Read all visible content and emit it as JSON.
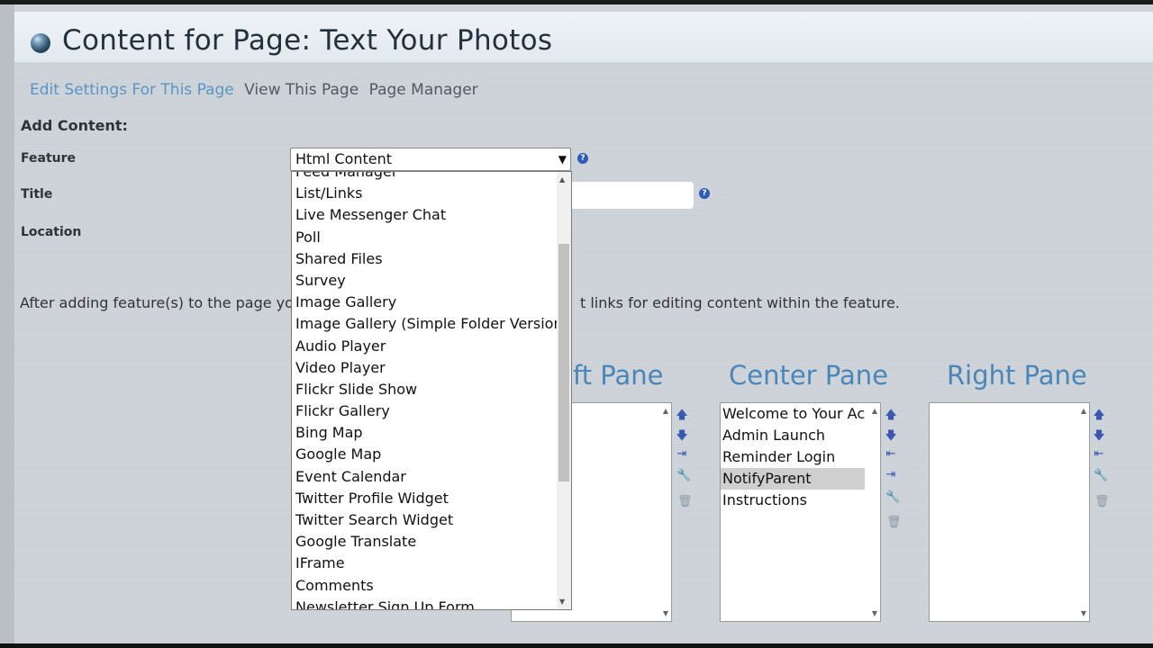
{
  "header": {
    "title": "Content for Page: Text Your Photos"
  },
  "nav": {
    "edit_settings": "Edit Settings For This Page",
    "view_page": "View This Page",
    "page_manager": "Page Manager"
  },
  "form": {
    "add_content": "Add Content:",
    "feature_label": "Feature",
    "title_label": "Title",
    "location_label": "Location",
    "feature_selected": "Html Content",
    "help_glyph": "?"
  },
  "info": {
    "part_a": "After adding feature(s) to the page you",
    "part_b": "t links for editing content within the feature."
  },
  "dropdown": {
    "options": [
      "Feed Manager",
      "List/Links",
      "Live Messenger Chat",
      "Poll",
      "Shared Files",
      "Survey",
      "Image Gallery",
      "Image Gallery (Simple Folder Version)",
      "Audio Player",
      "Video Player",
      "Flickr Slide Show",
      "Flickr Gallery",
      "Bing Map",
      "Google Map",
      "Event Calendar",
      "Twitter Profile Widget",
      "Twitter Search Widget",
      "Google Translate",
      "IFrame",
      "Comments",
      "Newsletter Sign Up Form"
    ]
  },
  "panes": {
    "left_title": "ft Pane",
    "center_title": "Center Pane",
    "right_title": "Right Pane",
    "center_items": [
      "Welcome to Your Acc",
      "Admin Launch",
      "Reminder Login",
      "NotifyParent",
      "Instructions"
    ],
    "center_selected": "NotifyParent"
  },
  "icons": {
    "up": "🡅",
    "down": "🡇",
    "move_right": "⇥",
    "move_left": "⇤",
    "edit": "🔧",
    "delete": "🗑"
  },
  "colors": {
    "link_active": "#5b95c6",
    "pane_title": "#4a86b9",
    "help": "#2b5db7"
  }
}
